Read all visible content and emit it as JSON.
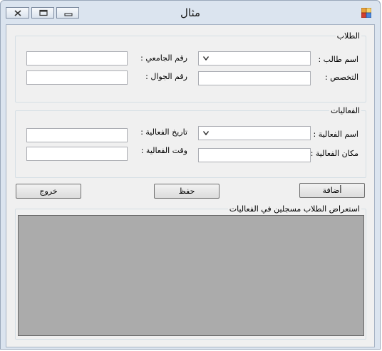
{
  "window": {
    "title": "مثال"
  },
  "students_group": {
    "legend": "الطلاب",
    "student_name_label": "اسم طالب :",
    "university_no_label": "رقم الجامعي :",
    "major_label": "التخصص :",
    "mobile_label": "رقم الجوال :",
    "student_name_value": "",
    "university_no_value": "",
    "major_value": "",
    "mobile_value": ""
  },
  "events_group": {
    "legend": "الفعاليات",
    "event_name_label": "اسم الفعالية :",
    "event_date_label": "تاريخ الفعالية :",
    "event_place_label": "مكان الفعالية :",
    "event_time_label": "وقت الفعالية :",
    "event_name_value": "",
    "event_date_value": "",
    "event_place_value": "",
    "event_time_value": ""
  },
  "actions": {
    "add_label": "أضافة",
    "save_label": "حفظ",
    "exit_label": "خروج"
  },
  "list_group": {
    "legend": "استعراض الطلاب مسجلين في الفعاليات"
  },
  "colors": {
    "grid_background": "#ababab",
    "client_background": "#f0f0f0"
  }
}
